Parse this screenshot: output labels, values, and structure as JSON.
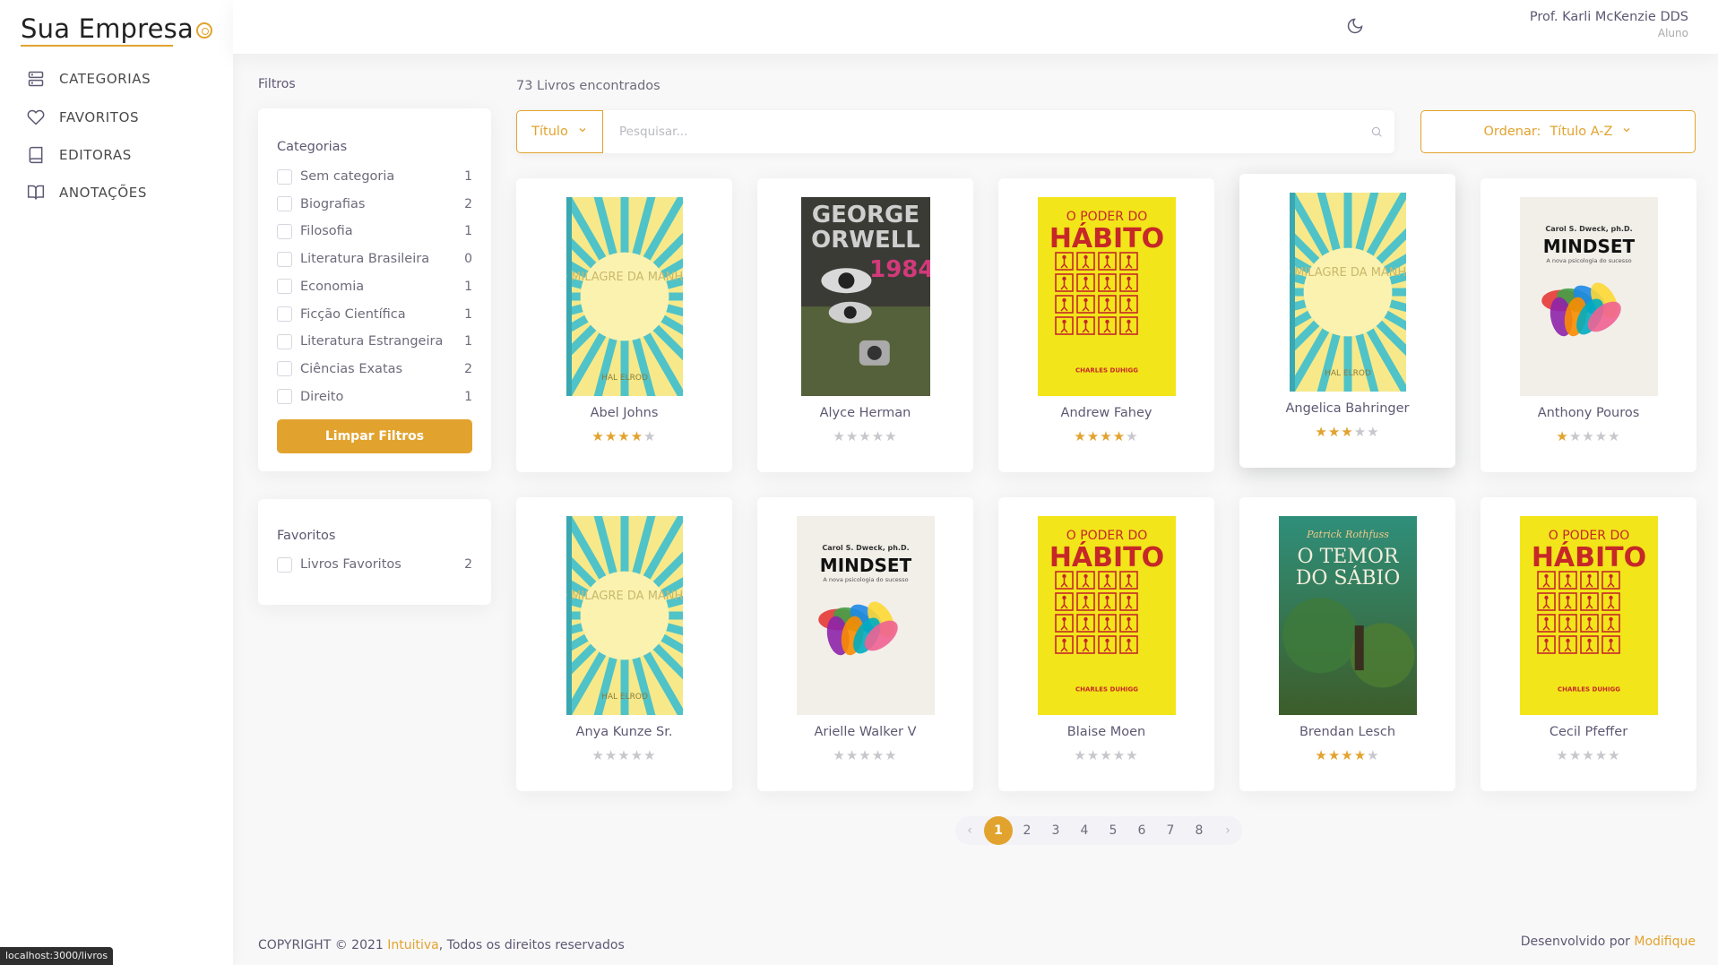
{
  "brand": {
    "name": "Sua Empresa"
  },
  "sidebar": {
    "items": [
      {
        "label": "CATEGORIAS",
        "icon": "server-icon"
      },
      {
        "label": "FAVORITOS",
        "icon": "heart-icon"
      },
      {
        "label": "EDITORAS",
        "icon": "book-icon"
      },
      {
        "label": "ANOTAÇÕES",
        "icon": "book-open-icon"
      }
    ]
  },
  "header": {
    "user_name": "Prof. Karli McKenzie DDS",
    "user_role": "Aluno",
    "theme_icon": "moon-icon"
  },
  "filters": {
    "title": "Filtros",
    "categories_title": "Categorias",
    "categories": [
      {
        "name": "Sem categoria",
        "count": "1"
      },
      {
        "name": "Biografias",
        "count": "2"
      },
      {
        "name": "Filosofia",
        "count": "1"
      },
      {
        "name": "Literatura Brasileira",
        "count": "0"
      },
      {
        "name": "Economia",
        "count": "1"
      },
      {
        "name": "Ficção Científica",
        "count": "1"
      },
      {
        "name": "Literatura Estrangeira",
        "count": "1"
      },
      {
        "name": "Ciências Exatas",
        "count": "2"
      },
      {
        "name": "Direito",
        "count": "1"
      }
    ],
    "clear_label": "Limpar Filtros",
    "favorites_title": "Favoritos",
    "favorites": [
      {
        "name": "Livros Favoritos",
        "count": "2"
      }
    ]
  },
  "results": {
    "count_label": "73 Livros encontrados",
    "search_type": "Título",
    "search_placeholder": "Pesquisar...",
    "sort_prefix": "Ordenar:",
    "sort_value": "Título A-Z"
  },
  "books": [
    {
      "name": "Abel Johns",
      "rating": 4,
      "cover": "milagre"
    },
    {
      "name": "Alyce Herman",
      "rating": 0,
      "cover": "orwell"
    },
    {
      "name": "Andrew Fahey",
      "rating": 4,
      "cover": "habito"
    },
    {
      "name": "Angelica Bahringer",
      "rating": 3,
      "cover": "milagre"
    },
    {
      "name": "Anthony Pouros",
      "rating": 1,
      "cover": "mindset"
    },
    {
      "name": "Anya Kunze Sr.",
      "rating": 0,
      "cover": "milagre"
    },
    {
      "name": "Arielle Walker V",
      "rating": 0,
      "cover": "mindset"
    },
    {
      "name": "Blaise Moen",
      "rating": 0,
      "cover": "habito"
    },
    {
      "name": "Brendan Lesch",
      "rating": 4,
      "cover": "temor"
    },
    {
      "name": "Cecil Pfeffer",
      "rating": 0,
      "cover": "habito"
    }
  ],
  "covers": {
    "milagre": {
      "title": "O MILAGRE DA MANHÃ",
      "author": "HAL ELROD"
    },
    "orwell": {
      "line1": "GEORGE",
      "line2": "ORWELL",
      "number": "1984"
    },
    "habito": {
      "line1": "O PODER DO",
      "line2": "HÁBITO",
      "author": "CHARLES DUHIGG"
    },
    "mindset": {
      "author": "Carol S. Dweck, ph.D.",
      "title": "MINDSET",
      "subtitle": "A nova psicologia do sucesso"
    },
    "temor": {
      "author": "Patrick Rothfuss",
      "line1": "O TEMOR",
      "line2": "DO SÁBIO"
    }
  },
  "pagination": {
    "pages": [
      "1",
      "2",
      "3",
      "4",
      "5",
      "6",
      "7",
      "8"
    ],
    "active": "1",
    "prev": "‹",
    "next": "›"
  },
  "footer": {
    "copyright_prefix": "COPYRIGHT © 2021 ",
    "company": "Intuitiva",
    "copyright_suffix": ", Todos os direitos reservados",
    "dev_prefix": "Desenvolvido por ",
    "dev_company": "Modifique"
  },
  "statusbar": {
    "url": "localhost:3000/livros"
  },
  "colors": {
    "accent": "#e2a32e",
    "yellow_cover": "#f2e51a",
    "red_cover": "#d32f2f"
  }
}
